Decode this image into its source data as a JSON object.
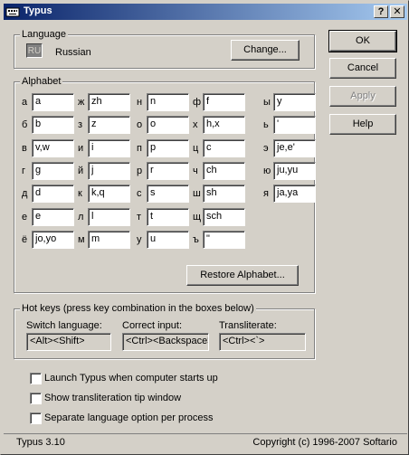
{
  "window": {
    "title": "Typus"
  },
  "language": {
    "group_label": "Language",
    "abbr": "RU",
    "name": "Russian",
    "change_label": "Change..."
  },
  "actions": {
    "ok": "OK",
    "cancel": "Cancel",
    "apply": "Apply",
    "help": "Help"
  },
  "alphabet": {
    "group_label": "Alphabet",
    "columns": [
      [
        {
          "letter": "а",
          "value": "a"
        },
        {
          "letter": "б",
          "value": "b"
        },
        {
          "letter": "в",
          "value": "v,w"
        },
        {
          "letter": "г",
          "value": "g"
        },
        {
          "letter": "д",
          "value": "d"
        },
        {
          "letter": "е",
          "value": "e"
        },
        {
          "letter": "ё",
          "value": "jo,yo"
        }
      ],
      [
        {
          "letter": "ж",
          "value": "zh"
        },
        {
          "letter": "з",
          "value": "z"
        },
        {
          "letter": "и",
          "value": "i"
        },
        {
          "letter": "й",
          "value": "j"
        },
        {
          "letter": "к",
          "value": "k,q"
        },
        {
          "letter": "л",
          "value": "l"
        },
        {
          "letter": "м",
          "value": "m"
        }
      ],
      [
        {
          "letter": "н",
          "value": "n"
        },
        {
          "letter": "о",
          "value": "o"
        },
        {
          "letter": "п",
          "value": "p"
        },
        {
          "letter": "р",
          "value": "r"
        },
        {
          "letter": "с",
          "value": "s"
        },
        {
          "letter": "т",
          "value": "t"
        },
        {
          "letter": "у",
          "value": "u"
        }
      ],
      [
        {
          "letter": "ф",
          "value": "f"
        },
        {
          "letter": "х",
          "value": "h,x"
        },
        {
          "letter": "ц",
          "value": "c"
        },
        {
          "letter": "ч",
          "value": "ch"
        },
        {
          "letter": "ш",
          "value": "sh"
        },
        {
          "letter": "щ",
          "value": "sch"
        },
        {
          "letter": "ъ",
          "value": "\""
        }
      ],
      [
        {
          "letter": "ы",
          "value": "y"
        },
        {
          "letter": "ь",
          "value": "'"
        },
        {
          "letter": "э",
          "value": "je,e'"
        },
        {
          "letter": "ю",
          "value": "ju,yu"
        },
        {
          "letter": "я",
          "value": "ja,ya"
        }
      ]
    ],
    "restore_label": "Restore Alphabet..."
  },
  "hotkeys": {
    "group_label": "Hot keys (press key combination in the boxes below)",
    "switch_label": "Switch language:",
    "switch_value": "<Alt><Shift>",
    "correct_label": "Correct input:",
    "correct_value": "<Ctrl><Backspace>",
    "translit_label": "Transliterate:",
    "translit_value": "<Ctrl><`>"
  },
  "options": [
    {
      "label": "Launch Typus when computer starts up",
      "checked": false
    },
    {
      "label": "Show transliteration tip window",
      "checked": false
    },
    {
      "label": "Separate language option per  process",
      "checked": false
    }
  ],
  "status": {
    "version": "Typus 3.10",
    "copyright": "Copyright (c) 1996-2007 Softario"
  }
}
